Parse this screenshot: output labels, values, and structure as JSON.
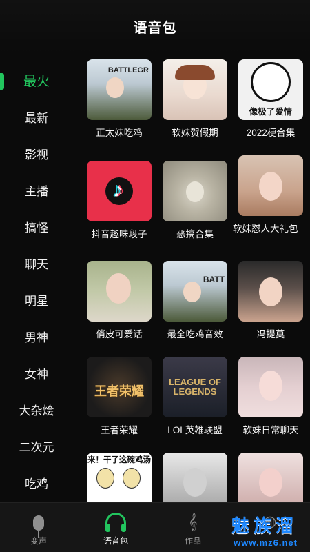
{
  "header": {
    "title": "语音包"
  },
  "sidebar": {
    "items": [
      {
        "label": "最火",
        "active": true
      },
      {
        "label": "最新"
      },
      {
        "label": "影视"
      },
      {
        "label": "主播"
      },
      {
        "label": "搞怪"
      },
      {
        "label": "聊天"
      },
      {
        "label": "明星"
      },
      {
        "label": "男神"
      },
      {
        "label": "女神"
      },
      {
        "label": "大杂烩"
      },
      {
        "label": "二次元"
      },
      {
        "label": "吃鸡"
      }
    ]
  },
  "grid": {
    "items": [
      {
        "label": "正太妹吃鸡",
        "thumb_text": "BATTLEGR"
      },
      {
        "label": "软妹贺假期"
      },
      {
        "label": "2022梗合集",
        "thumb_text": "像极了爱情"
      },
      {
        "label": "抖音趣味段子"
      },
      {
        "label": "恶搞合集"
      },
      {
        "label": "软妹怼人大礼包"
      },
      {
        "label": "俏皮可爱话"
      },
      {
        "label": "最全吃鸡音效",
        "thumb_text": "BATT"
      },
      {
        "label": "冯提莫"
      },
      {
        "label": "王者荣耀",
        "thumb_text": "王者荣耀"
      },
      {
        "label": "LOL英雄联盟",
        "thumb_text": "LEAGUE OF LEGENDS"
      },
      {
        "label": "软妹日常聊天"
      },
      {
        "label": "",
        "thumb_text": "来！干了这碗鸡汤"
      },
      {
        "label": ""
      },
      {
        "label": ""
      }
    ]
  },
  "bottom_nav": {
    "items": [
      {
        "label": "变声",
        "icon": "microphone-icon"
      },
      {
        "label": "语音包",
        "icon": "headphones-icon",
        "active": true
      },
      {
        "label": "作品",
        "icon": "music-note-icon"
      },
      {
        "label": "",
        "icon": "globe-icon"
      }
    ]
  },
  "watermark": {
    "title": "魅族溜",
    "url": "www.mz6.net"
  },
  "colors": {
    "accent": "#22c55e",
    "background": "#0b0b0b",
    "watermark": "#1e88ff"
  }
}
